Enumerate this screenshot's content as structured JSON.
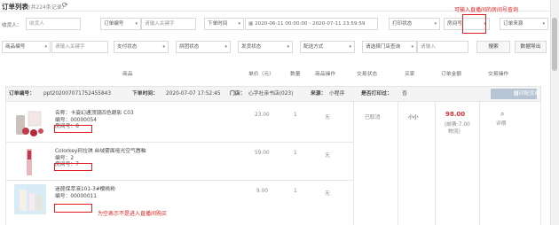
{
  "header": {
    "title": "订单列表",
    "count": "(共224条记录)"
  },
  "filters_row1": {
    "buyer_label": "收货人：",
    "buyer_placeholder": "收货人",
    "order_no_select": "订单编号",
    "keyword_placeholder": "请输入关键字",
    "time_select": "下单时间",
    "date_range": "2020-06-11 00:00:00 - 2020-07-11 23:59:59",
    "print_status": "打印状态",
    "room_label": "房间号",
    "order_source": "订单来源"
  },
  "filters_row2": {
    "goods_no_select": "商品编号",
    "keyword_placeholder": "请输入关键字",
    "pay_status": "支付状态",
    "group_status": "拼团状态",
    "ship_status": "发货状态",
    "delivery": "配送方式",
    "store_query": "请选择门店查询",
    "store_input": "请输入",
    "search_btn": "搜索",
    "export_btn": "数据导出"
  },
  "annotation_top": "可输入直播间的房间号查询",
  "annotation_bottom": "为空表示不是进入直播间购买",
  "table_headers": [
    "商品",
    "单价（元）",
    "数量",
    "商品操作",
    "交易状态",
    "买家",
    "订单金额",
    "交易操作"
  ],
  "order": {
    "order_no_label": "订单编号：",
    "order_no": "ppt202007071752455843",
    "time_label": "下单时间：",
    "time": "2020-07-07 17:52:45",
    "store_label": "门店：",
    "store": "心字社亲书店(023)",
    "source_label": "来源：",
    "source": "小程序",
    "printed_label": "是否打印过：",
    "printed": "否",
    "print_btn": "打印配货单",
    "status": "已取消",
    "buyer": "小小",
    "total": "98.00",
    "freight": "(邮费:7.00",
    "freight2": "物流)",
    "review": "评價"
  },
  "items": [
    {
      "name": "名称：卡姿幻通顶镜四色眼影 C03",
      "code": "编号：00000054",
      "room": "房间号：8",
      "price": "23.00",
      "qty": "1",
      "op": "无"
    },
    {
      "name": "Colorkey珂拉琪 丝绒雾面哑光空气唇釉",
      "code": "编号：2",
      "room": "房间号：7",
      "price": "59.00",
      "qty": "1",
      "op": "无"
    },
    {
      "name": "迷琵保萃液101-3#樱桃粉",
      "code": "编号：00000011",
      "room": "",
      "price": "9.00",
      "qty": "1",
      "op": "无"
    }
  ],
  "colors": {
    "accent": "#e02020",
    "price": "#d9343a"
  }
}
